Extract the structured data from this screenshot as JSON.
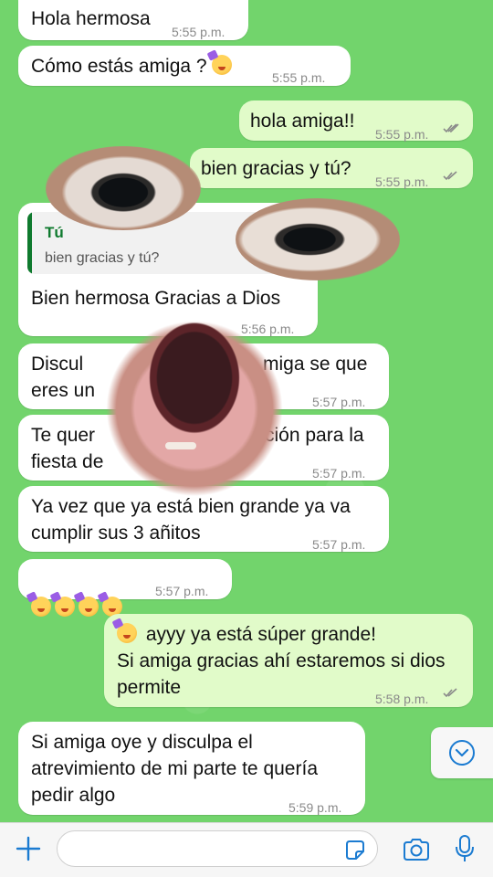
{
  "colors": {
    "wallpaper": "#72d46c",
    "incoming_bubble": "#ffffff",
    "outgoing_bubble": "#e1fbc9",
    "accent": "#1b7bd1",
    "quote_author": "#0f7a2e",
    "read_ticks": "#8a8a8a"
  },
  "messages": [
    {
      "direction": "in",
      "text": "Hola hermosa",
      "time": "5:55 p.m."
    },
    {
      "direction": "in",
      "text": "Cómo estás amiga ?",
      "emoji": "partying-face",
      "time": "5:55 p.m."
    },
    {
      "direction": "out",
      "text": "hola amiga!!",
      "time": "5:55 p.m.",
      "status": "read-double-check"
    },
    {
      "direction": "out",
      "text": "bien gracias y tú?",
      "time": "5:55 p.m.",
      "status": "read-double-check"
    },
    {
      "direction": "in",
      "quote": {
        "author": "Tú",
        "text": "bien gracias y tú?"
      },
      "text": "Bien hermosa Gracias a Dios",
      "time": "5:56 p.m."
    },
    {
      "direction": "in",
      "text_left": "Discul",
      "text_right": "miga se que",
      "text_line2": "eres un",
      "time": "5:57 p.m."
    },
    {
      "direction": "in",
      "text_left": "Te quer",
      "text_right": "ción para la",
      "text_line2": "fiesta de",
      "time": "5:57 p.m."
    },
    {
      "direction": "in",
      "text": "Ya vez que ya está bien grande ya va\ncumplir sus 3 añitos",
      "time": "5:57 p.m."
    },
    {
      "direction": "in",
      "emojis": [
        "partying-face",
        "partying-face",
        "partying-face",
        "partying-face"
      ],
      "time": "5:57 p.m."
    },
    {
      "direction": "out",
      "emoji": "smiling-face-with-hearts",
      "text_line1": "ayyy ya está súper grande!",
      "text": "Si amiga gracias ahí estaremos si dios\npermite",
      "time": "5:58 p.m.",
      "status": "read-double-check"
    },
    {
      "direction": "in",
      "text": "Si  amiga oye y disculpa el\natrevimiento de mi parte te quería\npedir algo",
      "time": "5:59 p.m."
    }
  ],
  "stickers": [
    "eye-left",
    "eye-right",
    "open-mouth"
  ],
  "composer": {
    "placeholder": "",
    "icons": [
      "plus-icon",
      "sticker-icon",
      "camera-icon",
      "microphone-icon"
    ]
  },
  "scroll_button_icon": "chevron-down-icon"
}
